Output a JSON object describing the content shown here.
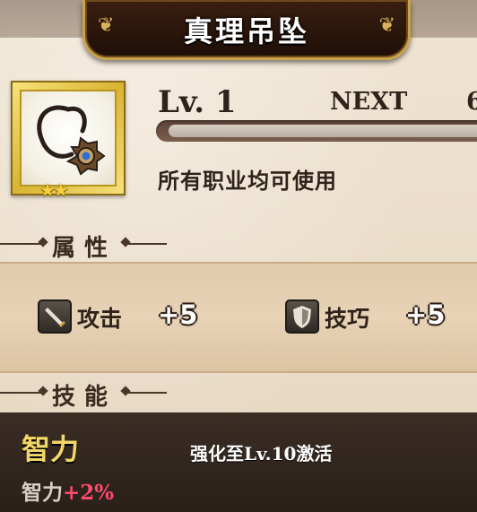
{
  "header": {
    "title": "真理吊坠"
  },
  "item": {
    "stars": "★★",
    "level": "Lv. 1",
    "next_label": "NEXT",
    "next_value": "6",
    "exp_progress": 0.0,
    "usable_text": "所有职业均可使用"
  },
  "attributes": {
    "section_title": "属性",
    "stats": [
      {
        "icon": "sword-icon",
        "label": "攻击",
        "value": "+5"
      },
      {
        "icon": "shield-icon",
        "label": "技巧",
        "value": "+5"
      }
    ]
  },
  "skill": {
    "section_title": "技能",
    "name": "智力",
    "unlock_condition": "强化至Lv.10激活",
    "effect_label": "智力",
    "effect_value": "+2%"
  },
  "colors": {
    "banner_gold": "#c9a24a",
    "skill_name": "#f3d765",
    "effect_plus": "#ff4a6e"
  }
}
